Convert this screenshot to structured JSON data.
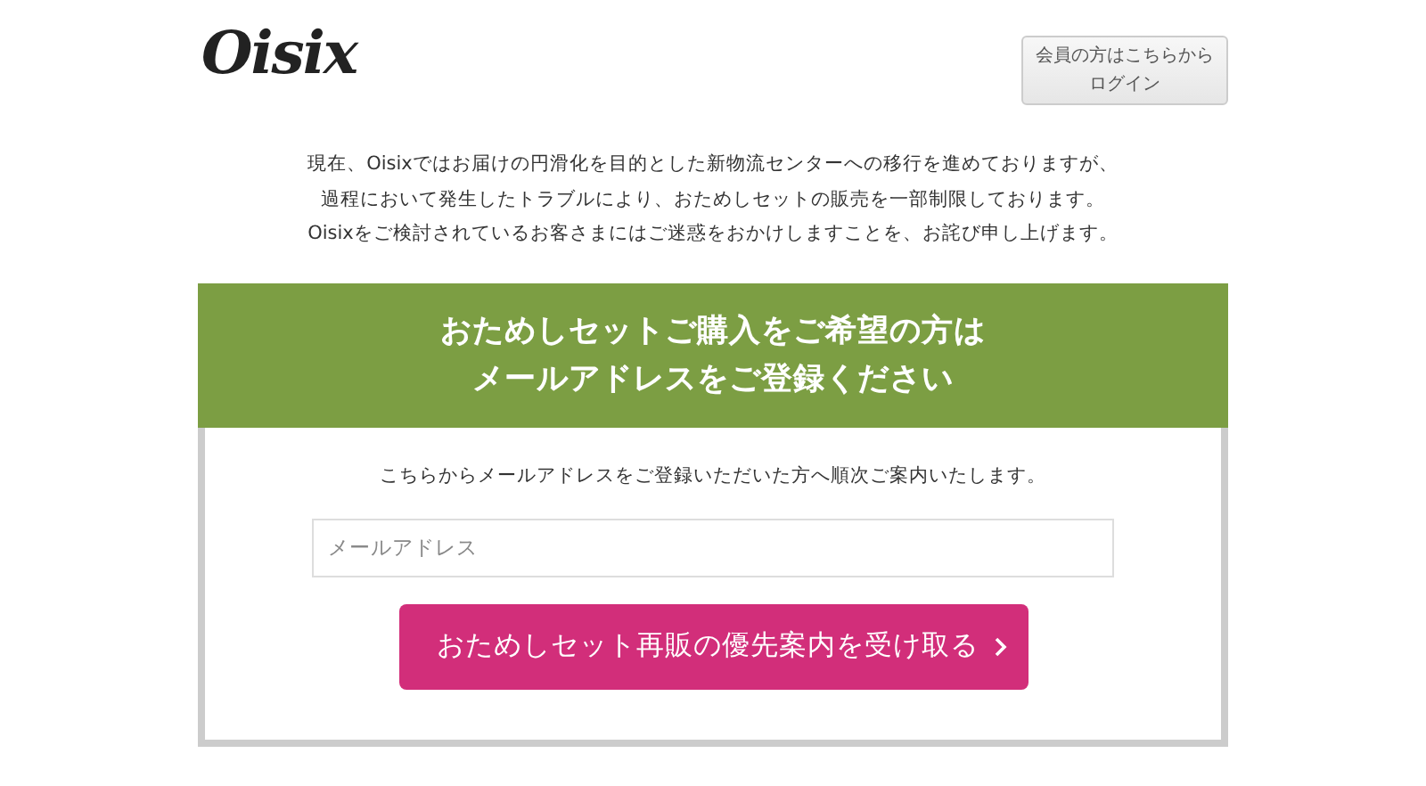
{
  "header": {
    "logo": "Oisix",
    "login_button": {
      "line_1": "会員の方はこちらから",
      "line_2": "ログイン"
    }
  },
  "notice": [
    "現在、Oisixではお届けの円滑化を目的とした新物流センターへの移行を進めておりますが、",
    "過程において発生したトラブルにより、おためしセットの販売を一部制限しております。",
    "Oisixをご検討されているお客さまにはご迷惑をおかけしますことを、お詫び申し上げます。"
  ],
  "panel": {
    "title": [
      "おためしセットご購入をご希望の方は",
      "メールアドレスをご登録ください"
    ],
    "description": "こちらからメールアドレスをご登録いただいた方へ順次ご案内いたします。",
    "email": {
      "placeholder": "メールアドレス"
    },
    "submit_button": "おためしセット再販の優先案内を受け取る"
  }
}
